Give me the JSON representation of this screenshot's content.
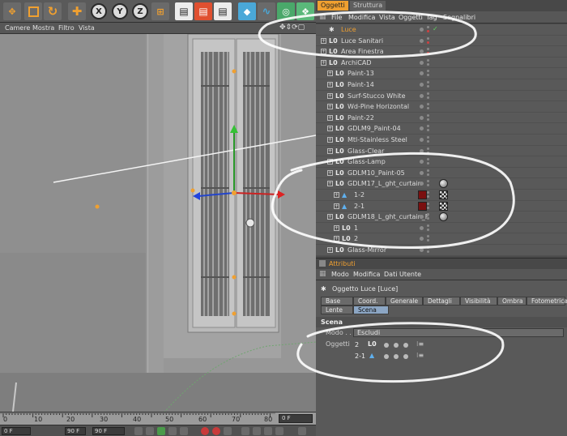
{
  "toolbar": {
    "buttons": [
      "move-tool",
      "scale-tool",
      "rotate-tool",
      "live-select",
      "x-axis",
      "y-axis",
      "z-axis",
      "world-coords",
      "render-view",
      "render-picture-viewer",
      "edit-render-settings",
      "cube",
      "spline",
      "nurbs",
      "array"
    ],
    "axis_x": "X",
    "axis_y": "Y",
    "axis_z": "Z"
  },
  "viewport_menu": [
    "Camere",
    "Mostra",
    "Filtro",
    "Vista"
  ],
  "timeline": {
    "ticks": [
      "0",
      "10",
      "20",
      "30",
      "40",
      "50",
      "60",
      "70",
      "80",
      "90"
    ],
    "frame": "0 F",
    "start_field": "0 F",
    "end_field": "90 F",
    "end_field2": "90 F"
  },
  "objects_panel": {
    "tabs": [
      "Oggetti",
      "Struttura"
    ],
    "menu": [
      "File",
      "Modifica",
      "Vista",
      "Oggetti",
      "Tag",
      "Segnalibri"
    ],
    "rows": [
      {
        "name": "Luce",
        "type": "light",
        "indent": 0,
        "tag": ""
      },
      {
        "name": "Luce Sanitari",
        "type": "null",
        "indent": 0,
        "tag": ""
      },
      {
        "name": "Area Finestra",
        "type": "null",
        "indent": 0,
        "tag": ""
      },
      {
        "name": "ArchiCAD",
        "type": "null",
        "indent": 0,
        "tag": ""
      },
      {
        "name": "Paint-13",
        "type": "null",
        "indent": 1,
        "tag": ""
      },
      {
        "name": "Paint-14",
        "type": "null",
        "indent": 1,
        "tag": ""
      },
      {
        "name": "Surf-Stucco White",
        "type": "null",
        "indent": 1,
        "tag": ""
      },
      {
        "name": "Wd-Pine Horizontal",
        "type": "null",
        "indent": 1,
        "tag": ""
      },
      {
        "name": "Paint-22",
        "type": "null",
        "indent": 1,
        "tag": ""
      },
      {
        "name": "GDLM9_Paint-04",
        "type": "null",
        "indent": 1,
        "tag": ""
      },
      {
        "name": "Mtl-Stainless Steel",
        "type": "null",
        "indent": 1,
        "tag": ""
      },
      {
        "name": "Glass-Clear",
        "type": "null",
        "indent": 1,
        "tag": ""
      },
      {
        "name": "Glass-Lamp",
        "type": "null",
        "indent": 1,
        "tag": ""
      },
      {
        "name": "GDLM10_Paint-05",
        "type": "null",
        "indent": 1,
        "tag": ""
      },
      {
        "name": "GDLM17_L_ght_curtain",
        "type": "null",
        "indent": 1,
        "tag": "sphere"
      },
      {
        "name": "1-2",
        "type": "poly",
        "indent": 2,
        "tag": "checker"
      },
      {
        "name": "2-1",
        "type": "poly",
        "indent": 2,
        "tag": "checker"
      },
      {
        "name": "GDLM18_L_ght_curtain_F",
        "type": "null",
        "indent": 1,
        "tag": "sphere"
      },
      {
        "name": "1",
        "type": "null",
        "indent": 2,
        "tag": ""
      },
      {
        "name": "2",
        "type": "null",
        "indent": 2,
        "tag": ""
      },
      {
        "name": "Glass-Mirror",
        "type": "null",
        "indent": 1,
        "tag": ""
      }
    ]
  },
  "attributes": {
    "title": "Attributi",
    "menu": [
      "Modo",
      "Modifica",
      "Dati Utente"
    ],
    "object_label": "Oggetto Luce [Luce]",
    "tabs_row1": [
      "Base",
      "Coord.",
      "Generale",
      "Dettagli",
      "Visibilità",
      "Ombra",
      "Fotometrica"
    ],
    "tabs_row2": [
      "Lente",
      "Scena"
    ],
    "active_tab": "Scena",
    "section": "Scena",
    "mode_label": "Modo . . .",
    "mode_value": "Escludi",
    "objects_label": "Oggetti",
    "objects": [
      {
        "name": "2",
        "type": "null"
      },
      {
        "name": "2-1",
        "type": "poly"
      }
    ]
  },
  "colors": {
    "accent_orange": "#f0a030",
    "selected_tab": "#8ca6c4",
    "annotation": "#ffffff"
  }
}
